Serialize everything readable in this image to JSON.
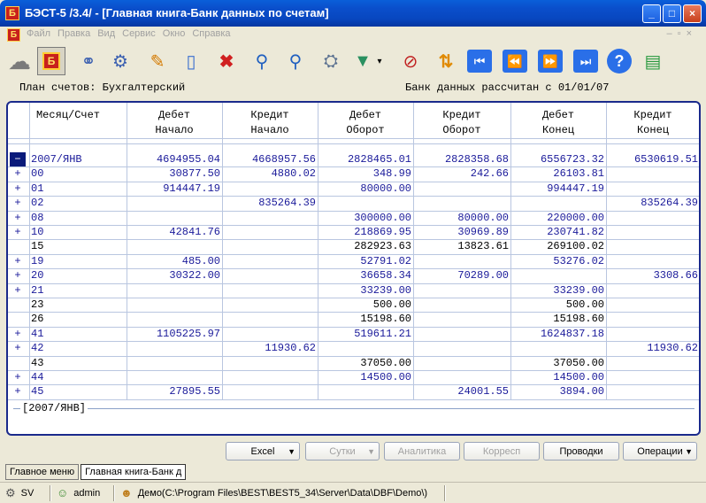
{
  "window": {
    "title": "БЭСТ-5 /3.4/ - [Главная книга-Банк данных по счетам]",
    "app_icon_letter": "Б"
  },
  "menu": {
    "items": [
      "Файл",
      "Правка",
      "Вид",
      "Сервис",
      "Окно",
      "Справка"
    ]
  },
  "info": {
    "plan": "План счетов: Бухгалтерский",
    "bank": "Банк данных рассчитан с 01/01/07"
  },
  "grid": {
    "headers": [
      {
        "line1": "",
        "line2": "Месяц/Счет"
      },
      {
        "line1": "Дебет",
        "line2": "Начало"
      },
      {
        "line1": "Кредит",
        "line2": "Начало"
      },
      {
        "line1": "Дебет",
        "line2": "Оборот"
      },
      {
        "line1": "Кредит",
        "line2": "Оборот"
      },
      {
        "line1": "Дебет",
        "line2": "Конец"
      },
      {
        "line1": "Кредит",
        "line2": "Конец"
      }
    ],
    "rows": [
      {
        "exp": "−",
        "acc": "2007/ЯНВ",
        "v": [
          "4694955.04",
          "4668957.56",
          "2828465.01",
          "2828358.68",
          "6556723.32",
          "6530619.51"
        ],
        "selected": true
      },
      {
        "exp": "+",
        "acc": "00",
        "v": [
          "30877.50",
          "4880.02",
          "348.99",
          "242.66",
          "26103.81",
          ""
        ]
      },
      {
        "exp": "+",
        "acc": "01",
        "v": [
          "914447.19",
          "",
          "80000.00",
          "",
          "994447.19",
          ""
        ]
      },
      {
        "exp": "+",
        "acc": "02",
        "v": [
          "",
          "835264.39",
          "",
          "",
          "",
          "835264.39"
        ]
      },
      {
        "exp": "+",
        "acc": "08",
        "v": [
          "",
          "",
          "300000.00",
          "80000.00",
          "220000.00",
          ""
        ]
      },
      {
        "exp": "+",
        "acc": "10",
        "v": [
          "42841.76",
          "",
          "218869.95",
          "30969.89",
          "230741.82",
          ""
        ]
      },
      {
        "exp": "",
        "acc": "15",
        "v": [
          "",
          "",
          "282923.63",
          "13823.61",
          "269100.02",
          ""
        ],
        "dark": true
      },
      {
        "exp": "+",
        "acc": "19",
        "v": [
          "485.00",
          "",
          "52791.02",
          "",
          "53276.02",
          ""
        ]
      },
      {
        "exp": "+",
        "acc": "20",
        "v": [
          "30322.00",
          "",
          "36658.34",
          "70289.00",
          "",
          "3308.66"
        ]
      },
      {
        "exp": "+",
        "acc": "21",
        "v": [
          "",
          "",
          "33239.00",
          "",
          "33239.00",
          ""
        ]
      },
      {
        "exp": "",
        "acc": "23",
        "v": [
          "",
          "",
          "500.00",
          "",
          "500.00",
          ""
        ],
        "dark": true
      },
      {
        "exp": "",
        "acc": "26",
        "v": [
          "",
          "",
          "15198.60",
          "",
          "15198.60",
          ""
        ],
        "dark": true
      },
      {
        "exp": "+",
        "acc": "41",
        "v": [
          "1105225.97",
          "",
          "519611.21",
          "",
          "1624837.18",
          ""
        ]
      },
      {
        "exp": "+",
        "acc": "42",
        "v": [
          "",
          "11930.62",
          "",
          "",
          "",
          "11930.62"
        ]
      },
      {
        "exp": "",
        "acc": "43",
        "v": [
          "",
          "",
          "37050.00",
          "",
          "37050.00",
          ""
        ],
        "dark": true
      },
      {
        "exp": "+",
        "acc": "44",
        "v": [
          "",
          "",
          "14500.00",
          "",
          "14500.00",
          ""
        ]
      },
      {
        "exp": "+",
        "acc": "45",
        "v": [
          "27895.55",
          "",
          "",
          "24001.55",
          "3894.00",
          ""
        ]
      }
    ],
    "footer": "[2007/ЯНВ]"
  },
  "buttons": [
    {
      "label": "Excel",
      "dropdown": true,
      "enabled": true
    },
    {
      "label": "Сутки",
      "dropdown": true,
      "enabled": false
    },
    {
      "label": "Аналитика",
      "dropdown": false,
      "enabled": false
    },
    {
      "label": "Корресп",
      "dropdown": false,
      "enabled": false
    },
    {
      "label": "Проводки",
      "dropdown": false,
      "enabled": true
    },
    {
      "label": "Операции",
      "dropdown": true,
      "enabled": true
    }
  ],
  "tabs": [
    "Главное меню",
    "Главная книга-Банк д"
  ],
  "status": {
    "code": "SV",
    "user": "admin",
    "database": "Демо(C:\\Program Files\\BEST\\BEST5_34\\Server\\Data\\DBF\\Demo\\)"
  },
  "toolbar": {
    "icons": [
      "cloud-icon",
      "best-app-icon",
      "link-icon",
      "link-settings-icon",
      "edit-pencil-icon",
      "new-document-icon",
      "delete-x-icon",
      "search-icon",
      "find-next-icon",
      "recalc-icon",
      "filter-icon",
      "no-filter-icon",
      "refresh-arrows-icon",
      "first-record-icon",
      "previous-record-icon",
      "next-record-icon",
      "last-record-icon",
      "help-icon",
      "export-doc-icon"
    ]
  },
  "colors": {
    "title_bar": "#0a4fcc",
    "grid_text": "#1a1a9a",
    "grid_line": "#b9c6e0",
    "selected_cell": "#0a1a7a"
  }
}
